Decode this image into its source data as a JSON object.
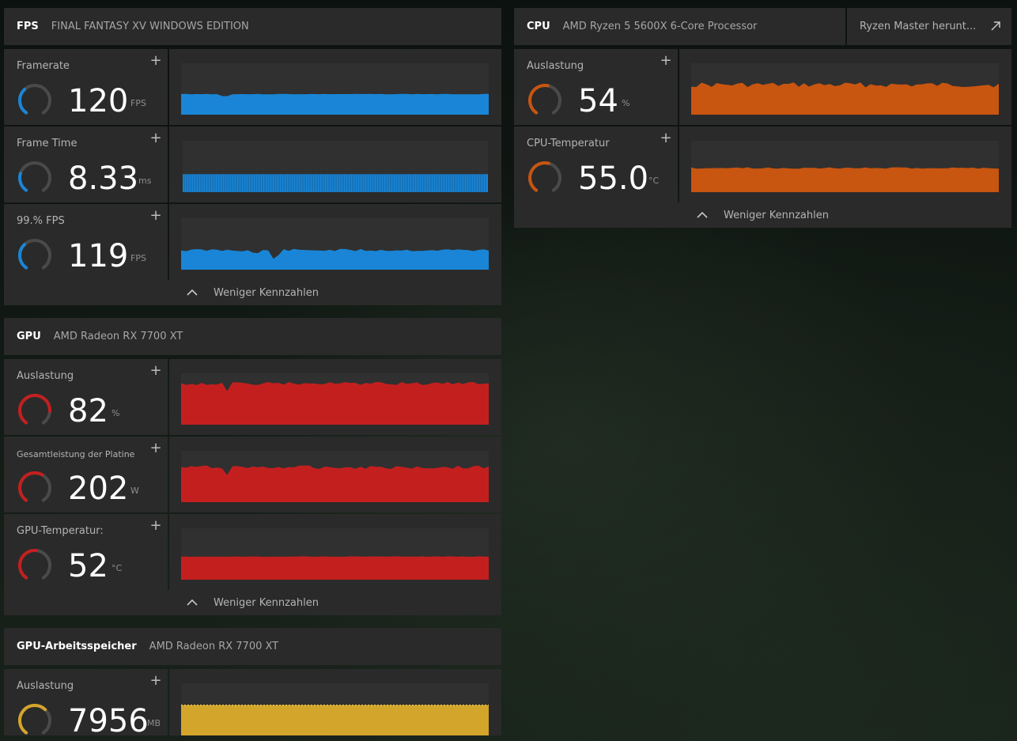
{
  "colors": {
    "fps": "#1a85d6",
    "cpu": "#c85510",
    "gpu": "#c41f1f",
    "vram": "#d3a52b",
    "panel": "#2a2a2a",
    "track": "#303030"
  },
  "fps": {
    "title": "FPS",
    "subtitle": "FINAL FANTASY XV WINDOWS EDITION",
    "metrics": [
      {
        "label": "Framerate",
        "value": "120",
        "unit": "FPS",
        "gauge_fraction": 0.35
      },
      {
        "label": "Frame Time",
        "value": "8.33",
        "unit": "ms",
        "gauge_fraction": 0.25
      },
      {
        "label": "99.% FPS",
        "value": "119",
        "unit": "FPS",
        "gauge_fraction": 0.35
      }
    ],
    "footer_label": "Weniger Kennzahlen"
  },
  "cpu": {
    "title": "CPU",
    "subtitle": "AMD Ryzen 5 5600X 6-Core Processor",
    "ryzen_master_label": "Ryzen Master herunt...",
    "metrics": [
      {
        "label": "Auslastung",
        "value": "54",
        "unit": "%",
        "gauge_fraction": 0.54
      },
      {
        "label": "CPU-Temperatur",
        "value": "55.0",
        "unit": "°C",
        "gauge_fraction": 0.55
      }
    ],
    "footer_label": "Weniger Kennzahlen"
  },
  "gpu": {
    "title": "GPU",
    "subtitle": "AMD Radeon RX 7700 XT",
    "metrics": [
      {
        "label": "Auslastung",
        "value": "82",
        "unit": "%",
        "gauge_fraction": 0.82
      },
      {
        "label": "Gesamtleistung der Platine",
        "value": "202",
        "unit": "W",
        "gauge_fraction": 0.6
      },
      {
        "label": "GPU-Temperatur:",
        "value": "52",
        "unit": "°C",
        "gauge_fraction": 0.52
      }
    ],
    "footer_label": "Weniger Kennzahlen"
  },
  "vram": {
    "title": "GPU-Arbeitsspeicher",
    "subtitle": "AMD Radeon RX 7700 XT",
    "metrics": [
      {
        "label": "Auslastung",
        "value": "7956",
        "unit": "MB",
        "gauge_fraction": 0.65
      }
    ]
  },
  "icons": {
    "plus": "plus-icon",
    "chevron": "chevron-up-icon",
    "external": "external-link-icon"
  }
}
